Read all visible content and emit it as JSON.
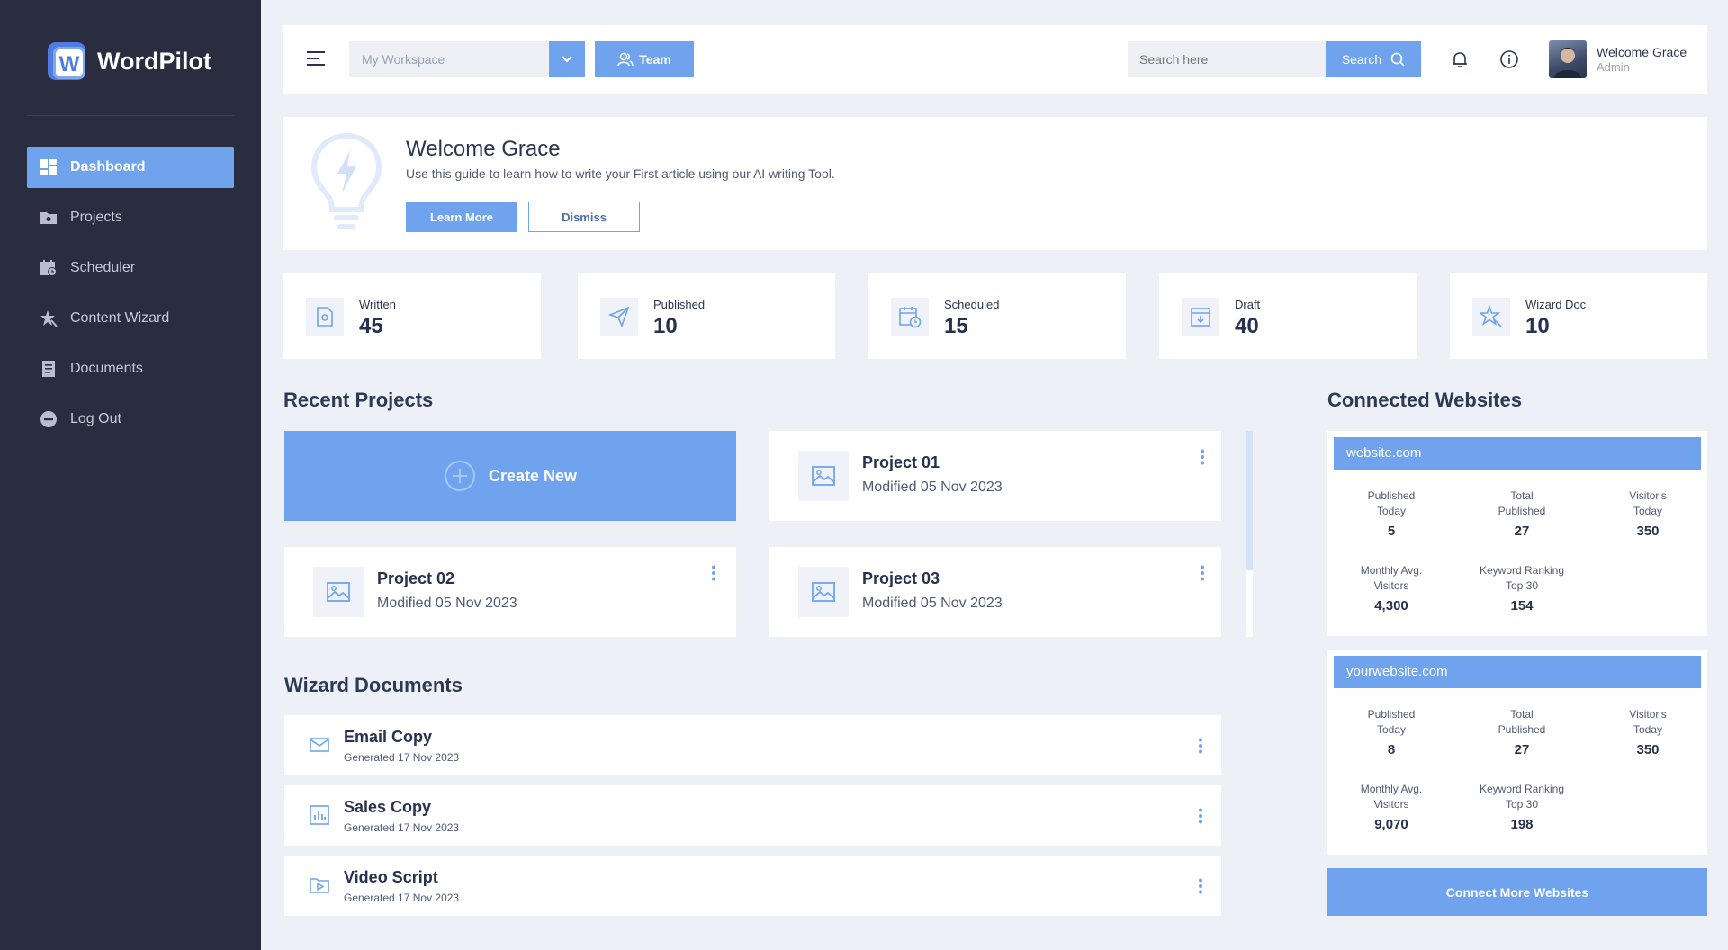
{
  "brand": {
    "name": "WordPilot",
    "logo_letter": "W"
  },
  "sidebar": {
    "items": [
      {
        "label": "Dashboard",
        "icon": "dashboard-icon",
        "active": true
      },
      {
        "label": "Projects",
        "icon": "folder-icon",
        "active": false
      },
      {
        "label": "Scheduler",
        "icon": "calendar-clock-icon",
        "active": false
      },
      {
        "label": "Content Wizard",
        "icon": "wizard-star-icon",
        "active": false
      },
      {
        "label": "Documents",
        "icon": "document-icon",
        "active": false
      },
      {
        "label": "Log Out",
        "icon": "logout-icon",
        "active": false
      }
    ]
  },
  "topbar": {
    "workspace_placeholder": "My Workspace",
    "team_label": "Team",
    "search_placeholder": "Search here",
    "search_label": "Search",
    "user_name": "Welcome Grace",
    "user_role": "Admin"
  },
  "welcome": {
    "title": "Welcome Grace",
    "subtitle": "Use this guide to learn how to write your First article using our AI writing Tool.",
    "learn_more": "Learn More",
    "dismiss": "Dismiss"
  },
  "stats": [
    {
      "label": "Written",
      "value": "45",
      "icon": "document-gear-icon"
    },
    {
      "label": "Published",
      "value": "10",
      "icon": "send-icon"
    },
    {
      "label": "Scheduled",
      "value": "15",
      "icon": "calendar-clock-icon"
    },
    {
      "label": "Draft",
      "value": "40",
      "icon": "inbox-download-icon"
    },
    {
      "label": "Wizard Doc",
      "value": "10",
      "icon": "wizard-star-icon"
    }
  ],
  "recent_projects": {
    "title": "Recent Projects",
    "create_new": "Create New",
    "items": [
      {
        "name": "Project 01",
        "modified": "Modified 05 Nov 2023"
      },
      {
        "name": "Project 02",
        "modified": "Modified 05 Nov 2023"
      },
      {
        "name": "Project 03",
        "modified": "Modified 05 Nov 2023"
      }
    ]
  },
  "wizard_documents": {
    "title": "Wizard Documents",
    "items": [
      {
        "name": "Email Copy",
        "generated": "Generated 17 Nov 2023",
        "icon": "mail-icon"
      },
      {
        "name": "Sales Copy",
        "generated": "Generated 17 Nov 2023",
        "icon": "bar-chart-icon"
      },
      {
        "name": "Video Script",
        "generated": "Generated 17 Nov 2023",
        "icon": "video-play-icon"
      }
    ]
  },
  "connected_websites": {
    "title": "Connected Websites",
    "sites": [
      {
        "domain": "website.com",
        "metrics": [
          {
            "label": "Published Today",
            "value": "5"
          },
          {
            "label": "Total Published",
            "value": "27"
          },
          {
            "label": "Visitor's Today",
            "value": "350"
          },
          {
            "label": "Monthly Avg. Visitors",
            "value": "4,300"
          },
          {
            "label": "Keyword Ranking Top 30",
            "value": "154"
          }
        ]
      },
      {
        "domain": "yourwebsite.com",
        "metrics": [
          {
            "label": "Published Today",
            "value": "8"
          },
          {
            "label": "Total Published",
            "value": "27"
          },
          {
            "label": "Visitor's Today",
            "value": "350"
          },
          {
            "label": "Monthly Avg. Visitors",
            "value": "9,070"
          },
          {
            "label": "Keyword Ranking Top 30",
            "value": "198"
          }
        ]
      }
    ],
    "connect_more": "Connect More Websites"
  },
  "colors": {
    "sidebar_bg": "#2a2c40",
    "accent": "#70a3ee",
    "page_bg": "#eef0f7",
    "text_dark": "#26324f"
  }
}
